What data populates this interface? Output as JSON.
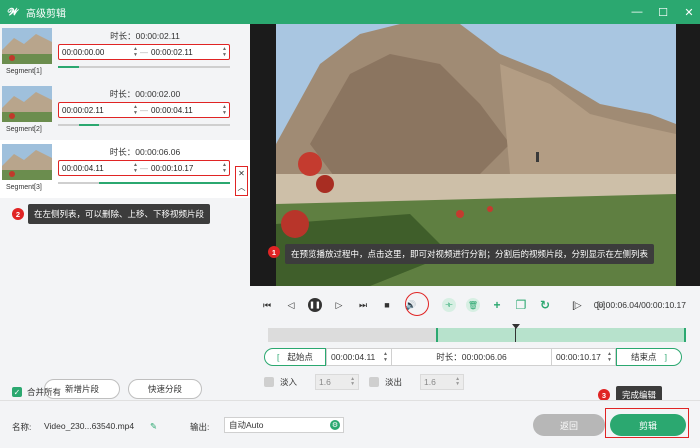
{
  "window": {
    "title": "高级剪辑",
    "logo_glyph": "𝓦"
  },
  "segments": [
    {
      "label": "Segment[1]",
      "duration_label": "时长：",
      "duration": "00:00:02.11",
      "start": "00:00:00.00",
      "end": "00:00:02.11",
      "bar_start": 0.0,
      "bar_end": 0.12
    },
    {
      "label": "Segment[2]",
      "duration_label": "时长：",
      "duration": "00:00:02.00",
      "start": "00:00:02.11",
      "end": "00:00:04.11",
      "bar_start": 0.12,
      "bar_end": 0.24
    },
    {
      "label": "Segment[3]",
      "duration_label": "时长：",
      "duration": "00:00:06.06",
      "start": "00:00:04.11",
      "end": "00:00:10.17",
      "bar_start": 0.24,
      "bar_end": 1.0
    }
  ],
  "tips": {
    "tip1": "在预览播放过程中，点击这里，即可对视频进行分割；分割后的视频片段，分别显示在左侧列表",
    "tip2": "在左侧列表，可以删除、上移、下移视频片段",
    "tip3": "完成编辑"
  },
  "badges": {
    "b1": "1",
    "b2": "2",
    "b3": "3"
  },
  "left_buttons": {
    "add_segment": "新增片段",
    "quick_split": "快速分段"
  },
  "merge": {
    "label": "合并所有",
    "checked": true
  },
  "player": {
    "timecode": "00:00:06.04/00:00:10.17",
    "playhead_fraction": 0.59
  },
  "edit": {
    "start_btn": "起始点",
    "start_value": "00:00:04.11",
    "duration_label": "时长：",
    "duration_value": "00:00:06.06",
    "end_value": "00:00:10.17",
    "end_btn": "结束点",
    "bracket_left": "[",
    "bracket_right": "]"
  },
  "fade": {
    "fade_in_label": "淡入",
    "fade_in_value": "1.6",
    "fade_out_label": "淡出",
    "fade_out_value": "1.6"
  },
  "bottom": {
    "name_label": "名称:",
    "name_value": "Video_230...63540.mp4",
    "output_label": "输出:",
    "output_value": "自动Auto",
    "back_button": "返回",
    "save_button": "剪辑"
  },
  "colors": {
    "accent": "#2ba870",
    "highlight": "#e02424"
  }
}
